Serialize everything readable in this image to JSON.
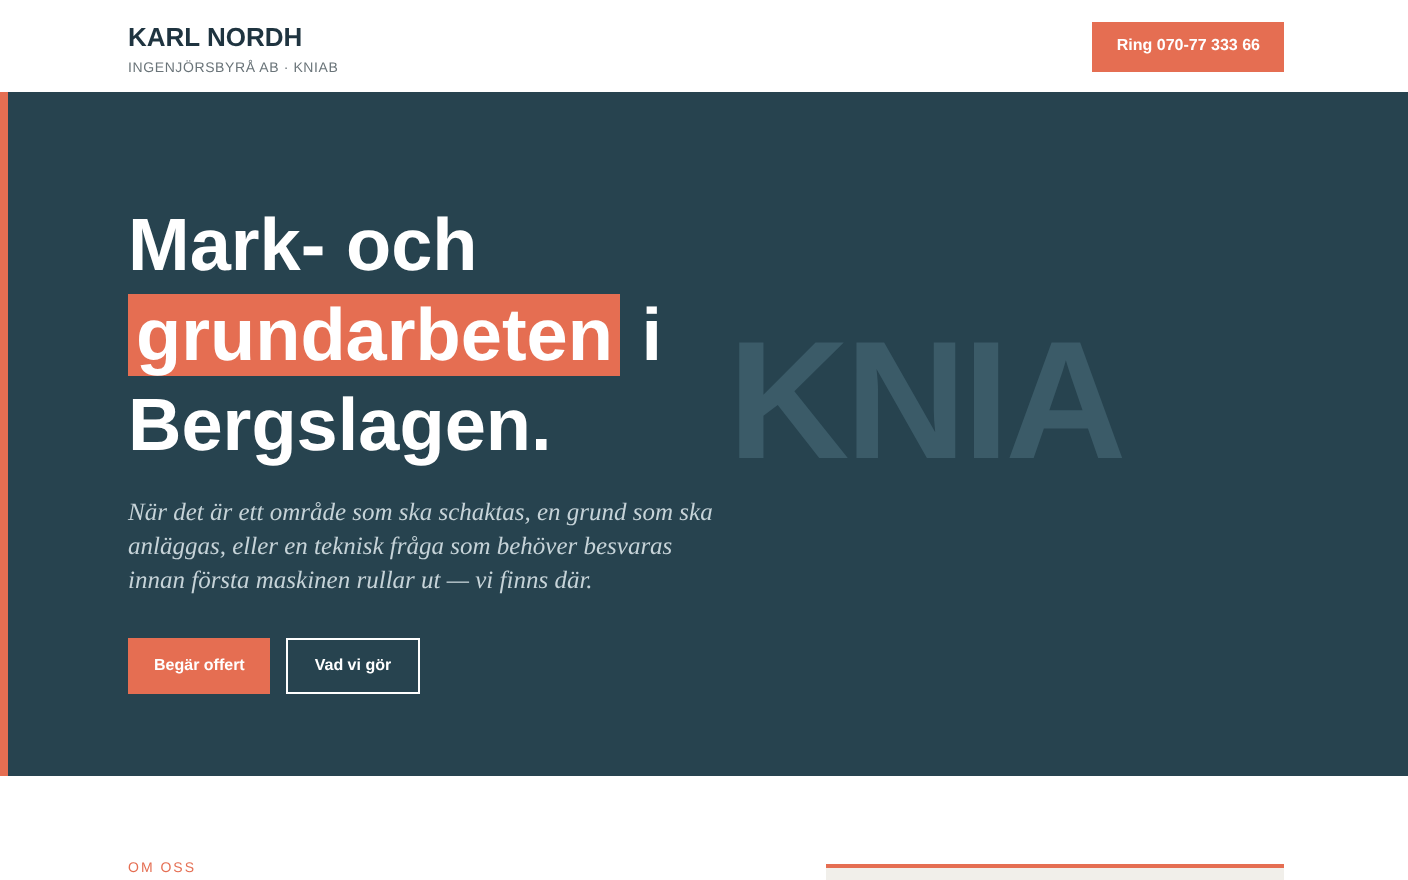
{
  "header": {
    "brand": "KARL NORDH",
    "tagline": "INGENJÖRSBYRÅ AB · KNIAB",
    "call_button": "Ring 070-77 333 66"
  },
  "hero": {
    "heading_before": "Mark- och",
    "heading_highlight": "grundarbeten",
    "heading_after": "i Bergslagen.",
    "backdrop_text": "KNIA",
    "intro": "När det är ett område som ska schaktas, en grund som ska anläggas, eller en teknisk fråga som behöver besvaras innan första maskinen rullar ut — vi finns där.",
    "buttons": [
      {
        "label": "Begär offert",
        "kind": "primary"
      },
      {
        "label": "Vad vi gör",
        "kind": "outline"
      }
    ]
  },
  "about": {
    "eyebrow": "OM OSS"
  }
}
